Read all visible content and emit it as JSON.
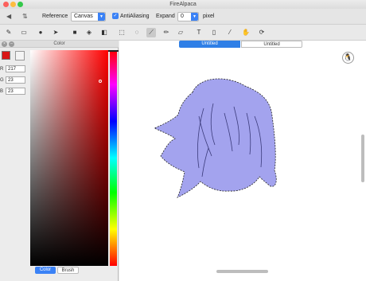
{
  "window": {
    "title": "FireAlpaca"
  },
  "toolbar": {
    "reference_label": "Reference",
    "reference_value": "Canvas",
    "antialiasing_label": "AntiAliasing",
    "expand_label": "Expand",
    "expand_value": "0",
    "unit_label": "pixel"
  },
  "color_panel": {
    "title": "Color",
    "primary_color": "#d91717",
    "secondary_color": "#f4f4f4",
    "r_label": "R",
    "r_value": "217",
    "g_label": "G",
    "g_value": "23",
    "b_label": "B",
    "b_value": "23",
    "tabs": [
      "Color",
      "Brush"
    ]
  },
  "canvas": {
    "tabs": [
      "Untitled",
      "Untitled"
    ],
    "fill_color": "#a3a3ee"
  },
  "colors": {
    "accent": "#3b82f6",
    "selection_fill": "#a3a3ee"
  }
}
